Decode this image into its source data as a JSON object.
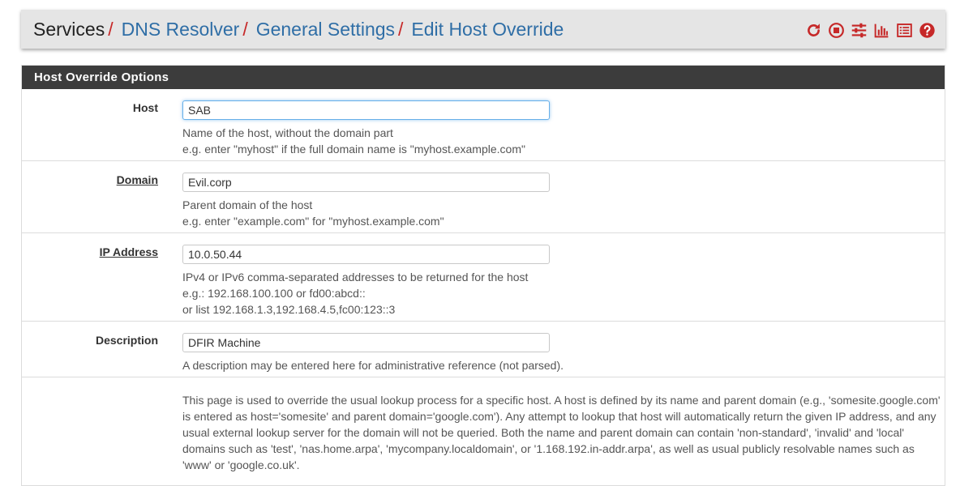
{
  "breadcrumb": {
    "home": "Services",
    "separator": "/",
    "items": [
      "DNS Resolver",
      "General Settings",
      "Edit Host Override"
    ]
  },
  "toolbar": {
    "icons": [
      "reload-icon",
      "stop-icon",
      "settings-sliders-icon",
      "chart-icon",
      "log-list-icon",
      "help-icon"
    ],
    "accent_color": "#c62828"
  },
  "panel": {
    "heading": "Host Override Options",
    "rows": [
      {
        "label": "Host",
        "value": "SAB",
        "help": [
          "Name of the host, without the domain part",
          "e.g. enter \"myhost\" if the full domain name is \"myhost.example.com\""
        ]
      },
      {
        "label": "Domain",
        "value": "Evil.corp",
        "help": [
          "Parent domain of the host",
          "e.g. enter \"example.com\" for \"myhost.example.com\""
        ]
      },
      {
        "label": "IP Address",
        "value": "10.0.50.44",
        "help": [
          "IPv4 or IPv6 comma-separated addresses to be returned for the host",
          "e.g.: 192.168.100.100 or fd00:abcd::",
          "or list 192.168.1.3,192.168.4.5,fc00:123::3"
        ]
      },
      {
        "label": "Description",
        "value": "DFIR Machine",
        "help": [
          "A description may be entered here for administrative reference (not parsed)."
        ]
      }
    ],
    "info": "This page is used to override the usual lookup process for a specific host. A host is defined by its name and parent domain (e.g., 'somesite.google.com' is entered as host='somesite' and parent domain='google.com'). Any attempt to lookup that host will automatically return the given IP address, and any usual external lookup server for the domain will not be queried. Both the name and parent domain can contain 'non-standard', 'invalid' and 'local' domains such as 'test', 'nas.home.arpa', 'mycompany.localdomain', or '1.168.192.in-addr.arpa', as well as usual publicly resolvable names such as 'www' or 'google.co.uk'."
  }
}
